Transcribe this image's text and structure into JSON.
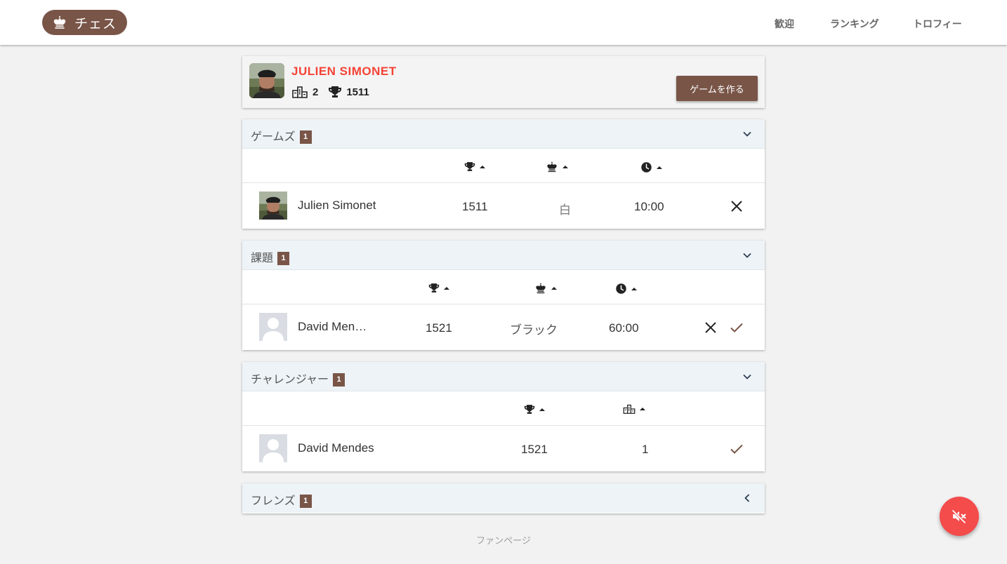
{
  "header": {
    "logo_text": "チェス",
    "nav": [
      "歓迎",
      "ランキング",
      "トロフィー"
    ]
  },
  "profile": {
    "name": "JULIEN SIMONET",
    "rank": "2",
    "trophies": "1511",
    "create_button": "ゲームを作る"
  },
  "games": {
    "title": "ゲームズ",
    "count": "1",
    "rows": [
      {
        "name": "Julien Simonet",
        "rating": "1511",
        "color": "白",
        "time": "10:00"
      }
    ]
  },
  "challenges": {
    "title": "課題",
    "count": "1",
    "rows": [
      {
        "name": "David Men…",
        "rating": "1521",
        "color": "ブラック",
        "time": "60:00"
      }
    ]
  },
  "challengers": {
    "title": "チャレンジャー",
    "count": "1",
    "rows": [
      {
        "name": "David Mendes",
        "rating": "1521",
        "rank": "1"
      }
    ]
  },
  "friends": {
    "title": "フレンズ",
    "count": "1"
  },
  "footer": {
    "fan_page": "ファンページ"
  },
  "colors": {
    "brand": "#795548",
    "accent": "#f44336",
    "panel_header": "#edf3f7"
  }
}
